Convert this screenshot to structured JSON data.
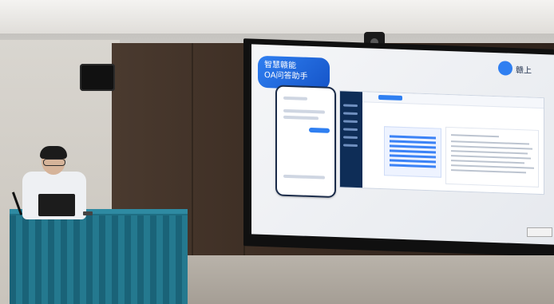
{
  "screen": {
    "badge_lines": [
      "智慧赣能",
      "OA问答助手"
    ],
    "logo_text": "赣上"
  }
}
